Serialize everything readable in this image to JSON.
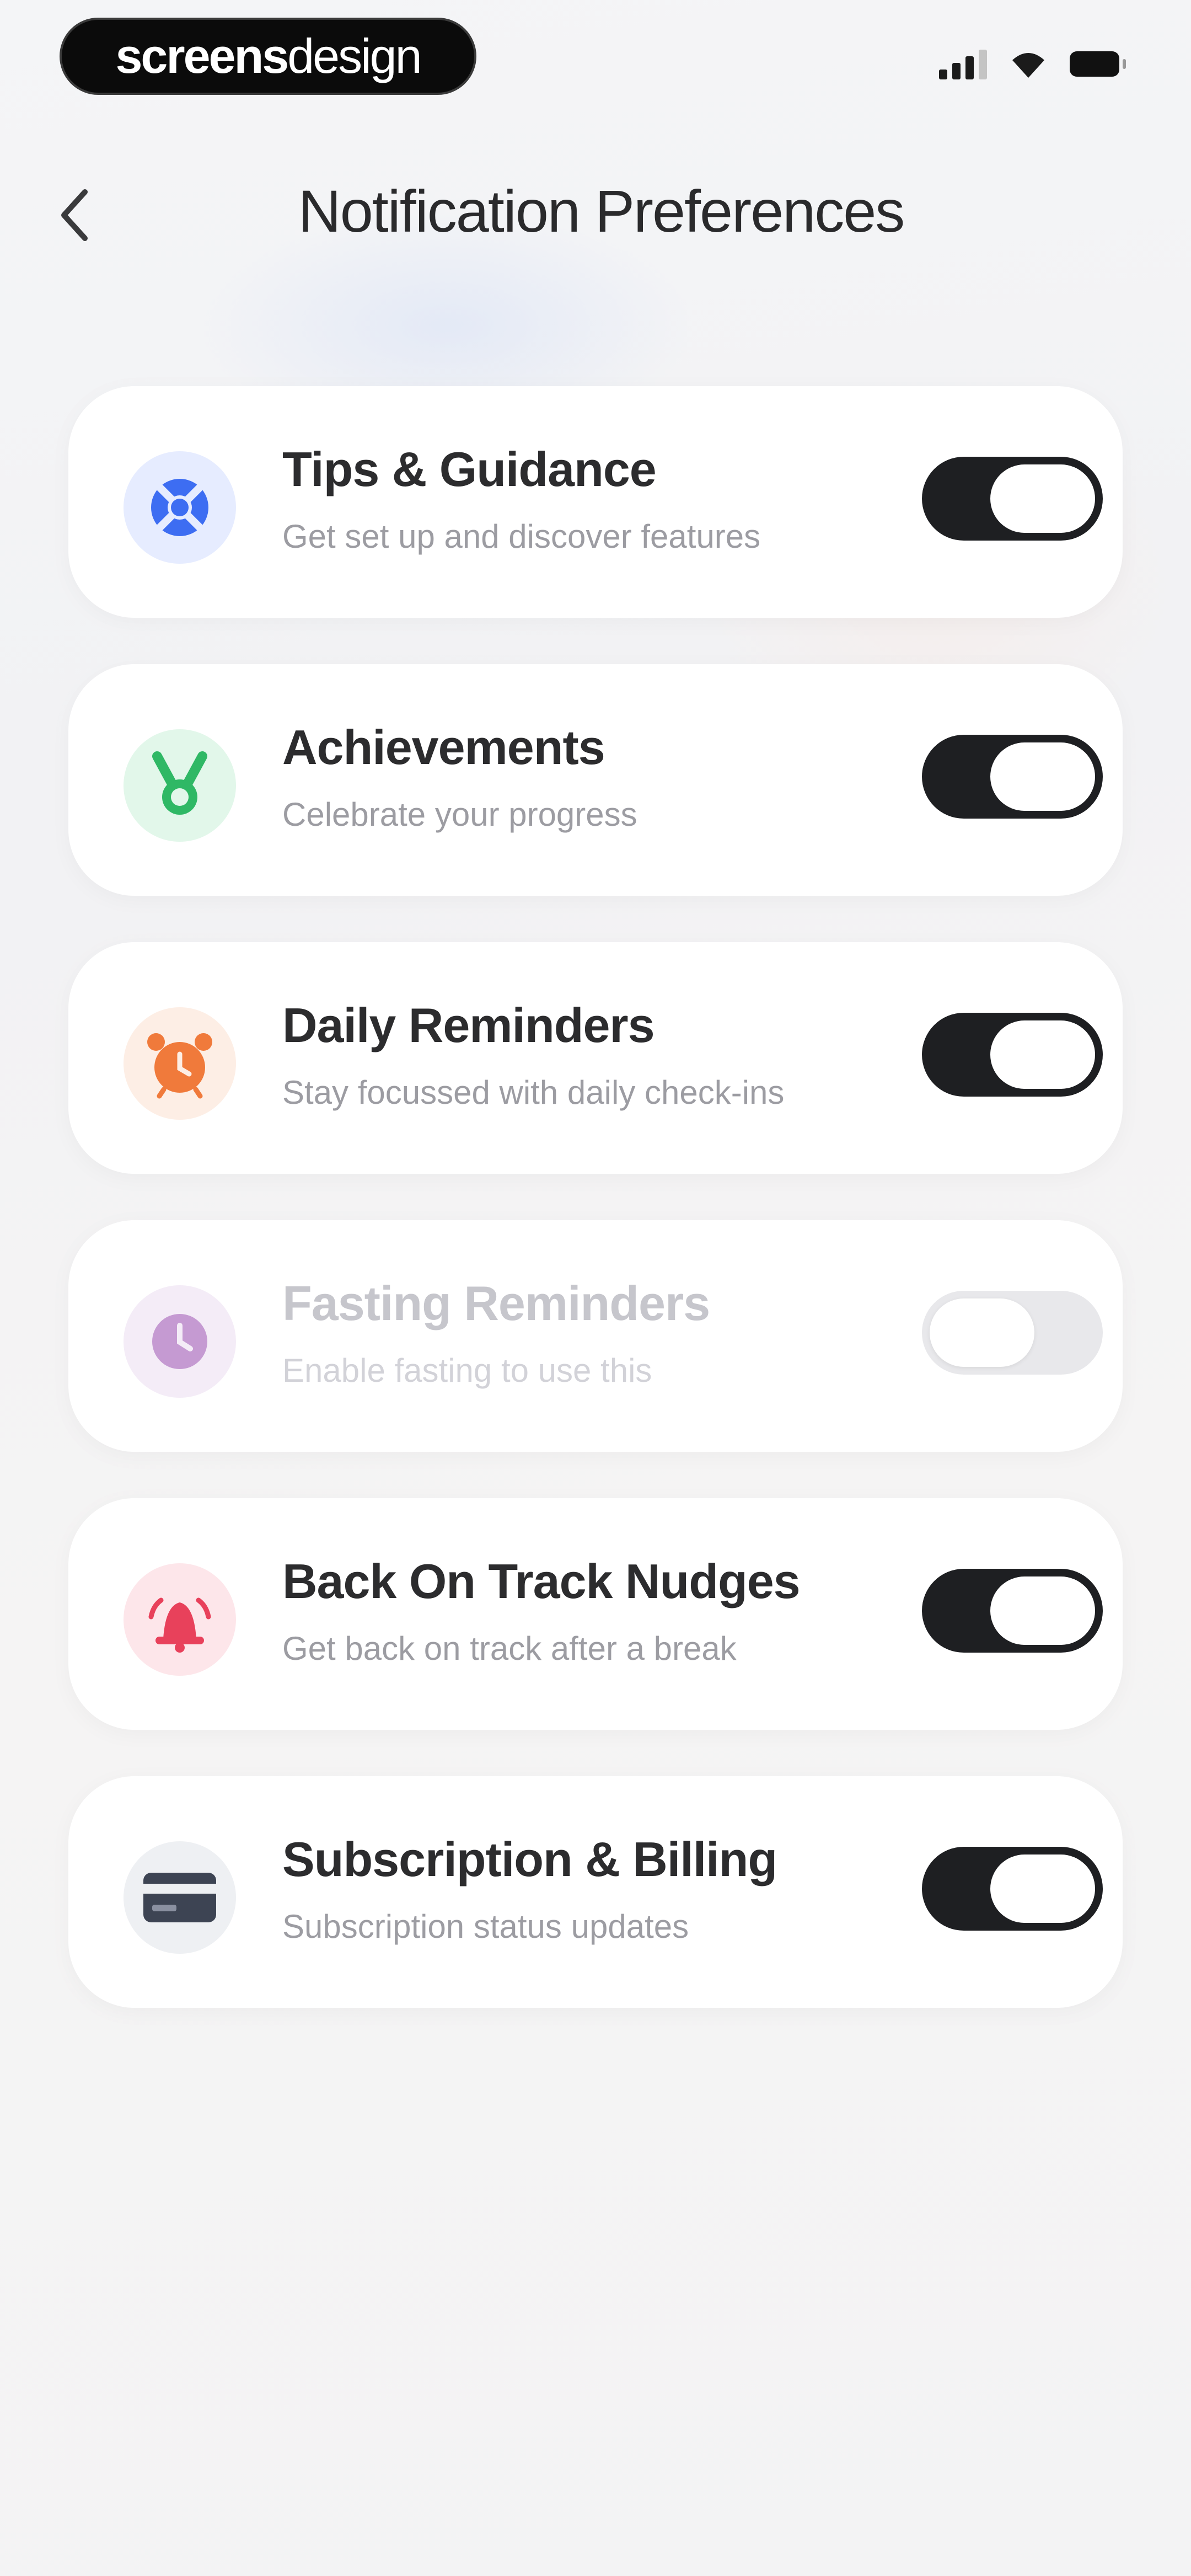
{
  "brand": {
    "part1": "screens",
    "part2": "design"
  },
  "header": {
    "back_label": "Back",
    "title": "Notification Preferences"
  },
  "items": [
    {
      "title": "Tips & Guidance",
      "subtitle": "Get set up and discover features",
      "enabled": true,
      "disabled": false,
      "icon": "lifebuoy-icon",
      "color": "#3d6df2",
      "bg": "#e6ecff"
    },
    {
      "title": "Achievements",
      "subtitle": "Celebrate your progress",
      "enabled": true,
      "disabled": false,
      "icon": "medal-icon",
      "color": "#2fb865",
      "bg": "#e2f7ea"
    },
    {
      "title": "Daily Reminders",
      "subtitle": "Stay focussed with daily check-ins",
      "enabled": true,
      "disabled": false,
      "icon": "alarm-clock-icon",
      "color": "#f07a3b",
      "bg": "#fdeee5"
    },
    {
      "title": "Fasting Reminders",
      "subtitle": "Enable fasting to use this",
      "enabled": false,
      "disabled": true,
      "icon": "clock-icon",
      "color": "#c59ad2",
      "bg": "#f4ecf7"
    },
    {
      "title": "Back On Track Nudges",
      "subtitle": "Get back on track after a break",
      "enabled": true,
      "disabled": false,
      "icon": "bell-icon",
      "color": "#e8415b",
      "bg": "#fde6ea"
    },
    {
      "title": "Subscription & Billing",
      "subtitle": "Subscription status updates",
      "enabled": true,
      "disabled": false,
      "icon": "credit-card-icon",
      "color": "#3d4453",
      "bg": "#eef0f3"
    }
  ]
}
